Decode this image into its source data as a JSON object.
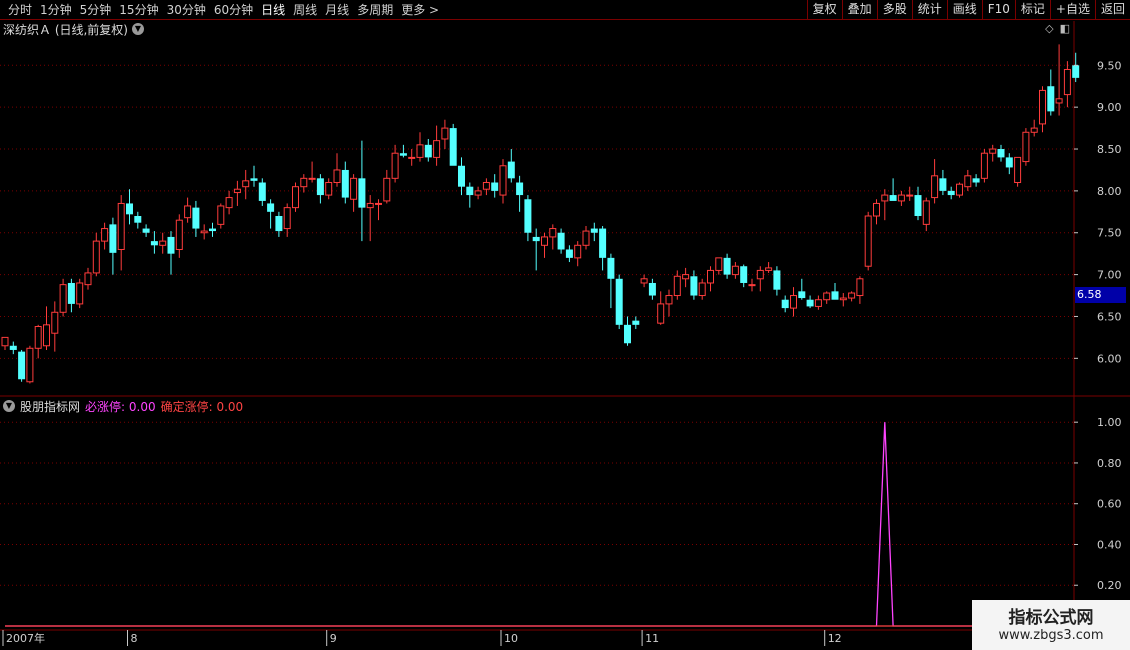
{
  "toolbar": {
    "periods": [
      {
        "label": "分时",
        "active": false
      },
      {
        "label": "1分钟",
        "active": false
      },
      {
        "label": "5分钟",
        "active": false
      },
      {
        "label": "15分钟",
        "active": false
      },
      {
        "label": "30分钟",
        "active": false
      },
      {
        "label": "60分钟",
        "active": false
      },
      {
        "label": "日线",
        "active": true
      },
      {
        "label": "周线",
        "active": false
      },
      {
        "label": "月线",
        "active": false
      },
      {
        "label": "多周期",
        "active": false
      },
      {
        "label": "更多 >",
        "active": false
      }
    ],
    "buttons": [
      "复权",
      "叠加",
      "多股",
      "统计",
      "画线",
      "F10",
      "标记",
      "+自选",
      "返回"
    ]
  },
  "main_chart": {
    "title": "深纺织Ａ (日线,前复权)",
    "menu_icon": "chevron-down-icon",
    "price_axis": [
      "9.50",
      "9.00",
      "8.50",
      "8.00",
      "7.50",
      "7.00",
      "6.50",
      "6.00"
    ],
    "current_price": "6.58"
  },
  "indicator": {
    "name": "股朋指标网",
    "line1_label": "必涨停: 0.00",
    "line2_label": "确定涨停: 0.00",
    "axis": [
      "1.00",
      "0.80",
      "0.60",
      "0.40",
      "0.20"
    ]
  },
  "time_axis": [
    {
      "label": "2007年",
      "index": 0
    },
    {
      "label": "8",
      "index": 15
    },
    {
      "label": "9",
      "index": 39
    },
    {
      "label": "10",
      "index": 60
    },
    {
      "label": "11",
      "index": 77
    },
    {
      "label": "12",
      "index": 99
    }
  ],
  "watermark": {
    "title": "指标公式网",
    "url": "www.zbgs3.com"
  },
  "colors": {
    "up": "#ff3c3c",
    "down": "#54ffff",
    "indicator": "#ff44ff",
    "grid": "#7a0000",
    "badge": "#0000a8"
  },
  "chart_data": {
    "type": "candlestick",
    "ylim": [
      5.55,
      9.85
    ],
    "candles": [
      [
        6.15,
        6.25,
        6.1,
        6.25
      ],
      [
        6.15,
        6.2,
        6.05,
        6.1
      ],
      [
        6.08,
        6.1,
        5.72,
        5.75
      ],
      [
        5.72,
        6.15,
        5.7,
        6.12
      ],
      [
        6.12,
        6.4,
        6.0,
        6.38
      ],
      [
        6.15,
        6.62,
        6.1,
        6.4
      ],
      [
        6.3,
        6.68,
        6.08,
        6.55
      ],
      [
        6.55,
        6.95,
        6.5,
        6.88
      ],
      [
        6.9,
        6.95,
        6.55,
        6.65
      ],
      [
        6.65,
        6.95,
        6.6,
        6.9
      ],
      [
        6.88,
        7.08,
        6.82,
        7.02
      ],
      [
        7.02,
        7.5,
        6.98,
        7.4
      ],
      [
        7.4,
        7.62,
        7.3,
        7.55
      ],
      [
        7.6,
        7.68,
        7.0,
        7.26
      ],
      [
        7.3,
        7.95,
        7.05,
        7.85
      ],
      [
        7.85,
        8.02,
        7.6,
        7.72
      ],
      [
        7.7,
        7.75,
        7.55,
        7.62
      ],
      [
        7.55,
        7.6,
        7.45,
        7.5
      ],
      [
        7.4,
        7.52,
        7.25,
        7.35
      ],
      [
        7.35,
        7.5,
        7.25,
        7.4
      ],
      [
        7.45,
        7.52,
        7.0,
        7.25
      ],
      [
        7.3,
        7.72,
        7.2,
        7.65
      ],
      [
        7.68,
        7.92,
        7.62,
        7.82
      ],
      [
        7.8,
        7.88,
        7.45,
        7.55
      ],
      [
        7.5,
        7.6,
        7.42,
        7.52
      ],
      [
        7.55,
        7.62,
        7.45,
        7.52
      ],
      [
        7.6,
        7.85,
        7.55,
        7.82
      ],
      [
        7.8,
        8.0,
        7.72,
        7.92
      ],
      [
        7.98,
        8.12,
        7.82,
        8.02
      ],
      [
        8.05,
        8.25,
        7.9,
        8.12
      ],
      [
        8.15,
        8.3,
        8.05,
        8.12
      ],
      [
        8.1,
        8.15,
        7.82,
        7.88
      ],
      [
        7.85,
        7.9,
        7.55,
        7.75
      ],
      [
        7.7,
        7.75,
        7.45,
        7.52
      ],
      [
        7.55,
        7.85,
        7.45,
        7.8
      ],
      [
        7.8,
        8.1,
        7.75,
        8.05
      ],
      [
        8.05,
        8.2,
        7.98,
        8.15
      ],
      [
        8.15,
        8.35,
        8.1,
        8.15
      ],
      [
        8.15,
        8.2,
        7.85,
        7.95
      ],
      [
        7.95,
        8.15,
        7.9,
        8.1
      ],
      [
        8.1,
        8.45,
        8.05,
        8.25
      ],
      [
        8.25,
        8.35,
        7.85,
        7.92
      ],
      [
        7.9,
        8.2,
        7.75,
        8.15
      ],
      [
        8.15,
        8.6,
        7.4,
        7.8
      ],
      [
        7.8,
        7.95,
        7.4,
        7.85
      ],
      [
        7.85,
        7.9,
        7.65,
        7.85
      ],
      [
        7.88,
        8.25,
        7.85,
        8.15
      ],
      [
        8.15,
        8.55,
        8.1,
        8.45
      ],
      [
        8.45,
        8.55,
        8.4,
        8.42
      ],
      [
        8.4,
        8.5,
        8.3,
        8.4
      ],
      [
        8.4,
        8.7,
        8.35,
        8.55
      ],
      [
        8.55,
        8.62,
        8.35,
        8.4
      ],
      [
        8.4,
        8.78,
        8.3,
        8.6
      ],
      [
        8.62,
        8.85,
        8.5,
        8.75
      ],
      [
        8.75,
        8.8,
        8.35,
        8.3
      ],
      [
        8.3,
        8.4,
        7.95,
        8.05
      ],
      [
        8.05,
        8.1,
        7.8,
        7.95
      ],
      [
        7.95,
        8.05,
        7.9,
        8.0
      ],
      [
        8.02,
        8.15,
        7.95,
        8.1
      ],
      [
        8.1,
        8.2,
        7.92,
        8.0
      ],
      [
        7.95,
        8.38,
        7.85,
        8.3
      ],
      [
        8.35,
        8.5,
        8.1,
        8.15
      ],
      [
        8.1,
        8.18,
        7.75,
        7.95
      ],
      [
        7.9,
        7.95,
        7.4,
        7.5
      ],
      [
        7.45,
        7.55,
        7.05,
        7.4
      ],
      [
        7.35,
        7.5,
        7.2,
        7.45
      ],
      [
        7.45,
        7.6,
        7.3,
        7.55
      ],
      [
        7.5,
        7.55,
        7.25,
        7.3
      ],
      [
        7.3,
        7.35,
        7.15,
        7.2
      ],
      [
        7.2,
        7.4,
        7.1,
        7.35
      ],
      [
        7.35,
        7.58,
        7.3,
        7.52
      ],
      [
        7.55,
        7.62,
        7.4,
        7.5
      ],
      [
        7.55,
        7.58,
        7.05,
        7.2
      ],
      [
        7.2,
        7.25,
        6.6,
        6.95
      ],
      [
        6.95,
        7.0,
        6.35,
        6.4
      ],
      [
        6.4,
        6.5,
        6.15,
        6.18
      ],
      [
        6.45,
        6.5,
        6.35,
        6.4
      ],
      [
        6.9,
        7.0,
        6.85,
        6.95
      ],
      [
        6.9,
        6.95,
        6.7,
        6.75
      ],
      [
        6.42,
        6.8,
        6.4,
        6.65
      ],
      [
        6.65,
        6.82,
        6.5,
        6.75
      ],
      [
        6.75,
        7.05,
        6.7,
        6.98
      ],
      [
        6.95,
        7.08,
        6.85,
        7.0
      ],
      [
        6.98,
        7.05,
        6.7,
        6.75
      ],
      [
        6.75,
        6.95,
        6.7,
        6.9
      ],
      [
        6.9,
        7.1,
        6.8,
        7.05
      ],
      [
        7.05,
        7.2,
        7.0,
        7.2
      ],
      [
        7.2,
        7.25,
        6.95,
        7.0
      ],
      [
        7.0,
        7.15,
        6.95,
        7.1
      ],
      [
        7.1,
        7.12,
        6.85,
        6.9
      ],
      [
        6.88,
        6.95,
        6.8,
        6.88
      ],
      [
        6.95,
        7.1,
        6.8,
        7.05
      ],
      [
        7.05,
        7.15,
        7.02,
        7.08
      ],
      [
        7.05,
        7.1,
        6.75,
        6.82
      ],
      [
        6.7,
        6.75,
        6.55,
        6.6
      ],
      [
        6.6,
        6.85,
        6.5,
        6.75
      ],
      [
        6.8,
        6.95,
        6.7,
        6.72
      ],
      [
        6.7,
        6.75,
        6.6,
        6.62
      ],
      [
        6.62,
        6.75,
        6.58,
        6.7
      ],
      [
        6.7,
        6.8,
        6.65,
        6.78
      ],
      [
        6.8,
        6.9,
        6.75,
        6.7
      ],
      [
        6.7,
        6.78,
        6.62,
        6.72
      ],
      [
        6.72,
        6.8,
        6.68,
        6.78
      ],
      [
        6.75,
        6.98,
        6.65,
        6.95
      ],
      [
        7.1,
        7.75,
        7.05,
        7.7
      ],
      [
        7.7,
        7.9,
        7.6,
        7.85
      ],
      [
        7.88,
        8.02,
        7.65,
        7.95
      ],
      [
        7.95,
        8.15,
        7.9,
        7.88
      ],
      [
        7.88,
        8.0,
        7.82,
        7.95
      ],
      [
        7.95,
        8.05,
        7.88,
        7.95
      ],
      [
        7.95,
        8.05,
        7.65,
        7.7
      ],
      [
        7.6,
        7.92,
        7.52,
        7.88
      ],
      [
        7.92,
        8.38,
        7.85,
        8.18
      ],
      [
        8.15,
        8.25,
        7.95,
        8.0
      ],
      [
        8.0,
        8.05,
        7.9,
        7.95
      ],
      [
        7.95,
        8.1,
        7.92,
        8.08
      ],
      [
        8.05,
        8.25,
        8.0,
        8.18
      ],
      [
        8.15,
        8.2,
        8.05,
        8.1
      ],
      [
        8.15,
        8.5,
        8.1,
        8.45
      ],
      [
        8.45,
        8.55,
        8.35,
        8.5
      ],
      [
        8.5,
        8.55,
        8.35,
        8.4
      ],
      [
        8.4,
        8.45,
        8.2,
        8.28
      ],
      [
        8.1,
        8.4,
        8.05,
        8.4
      ],
      [
        8.35,
        8.75,
        8.3,
        8.7
      ],
      [
        8.7,
        8.85,
        8.65,
        8.75
      ],
      [
        8.8,
        9.25,
        8.7,
        9.2
      ],
      [
        9.25,
        9.45,
        8.9,
        8.95
      ],
      [
        9.05,
        9.75,
        8.9,
        9.1
      ],
      [
        9.15,
        9.55,
        9.0,
        9.45
      ],
      [
        9.5,
        9.65,
        9.3,
        9.35
      ]
    ],
    "indicator_series": [
      {
        "name": "必涨停",
        "color": "#ff44ff",
        "spike_index": 106,
        "spike_value": 1.0
      },
      {
        "name": "确定涨停",
        "color": "#ff4444",
        "spike_index": -1,
        "spike_value": 0.0
      }
    ],
    "indicator_ylim": [
      0,
      1.0
    ]
  }
}
